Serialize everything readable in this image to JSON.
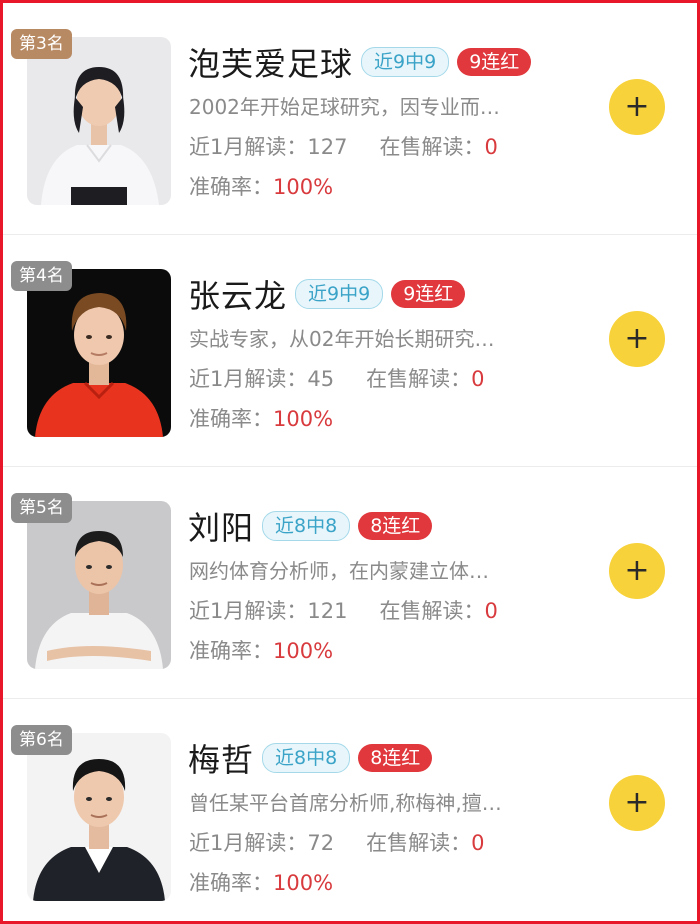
{
  "experts": [
    {
      "rank": "第3名",
      "name": "泡芙爱足球",
      "hit_tag": "近9中9",
      "streak_tag": "9连红",
      "desc": "2002年开始足球研究，因专业而…",
      "recent_label": "近1月解读：",
      "recent_value": "127",
      "sale_label": "在售解读：",
      "sale_value": "0",
      "acc_label": "准确率：",
      "acc_value": "100%",
      "add_icon": "plus-icon"
    },
    {
      "rank": "第4名",
      "name": "张云龙",
      "hit_tag": "近9中9",
      "streak_tag": "9连红",
      "desc": "实战专家，从02年开始长期研究…",
      "recent_label": "近1月解读：",
      "recent_value": "45",
      "sale_label": "在售解读：",
      "sale_value": "0",
      "acc_label": "准确率：",
      "acc_value": "100%",
      "add_icon": "plus-icon"
    },
    {
      "rank": "第5名",
      "name": "刘阳",
      "hit_tag": "近8中8",
      "streak_tag": "8连红",
      "desc": "网约体育分析师，在内蒙建立体…",
      "recent_label": "近1月解读：",
      "recent_value": "121",
      "sale_label": "在售解读：",
      "sale_value": "0",
      "acc_label": "准确率：",
      "acc_value": "100%",
      "add_icon": "plus-icon"
    },
    {
      "rank": "第6名",
      "name": "梅哲",
      "hit_tag": "近8中8",
      "streak_tag": "8连红",
      "desc": "曾任某平台首席分析师,称梅神,擅…",
      "recent_label": "近1月解读：",
      "recent_value": "72",
      "sale_label": "在售解读：",
      "sale_value": "0",
      "acc_label": "准确率：",
      "acc_value": "100%",
      "add_icon": "plus-icon"
    }
  ],
  "colors": {
    "accent_red": "#e0383c",
    "add_button": "#f7d23a",
    "hit_tag_text": "#3aa3c7",
    "frame": "#e8182a"
  }
}
